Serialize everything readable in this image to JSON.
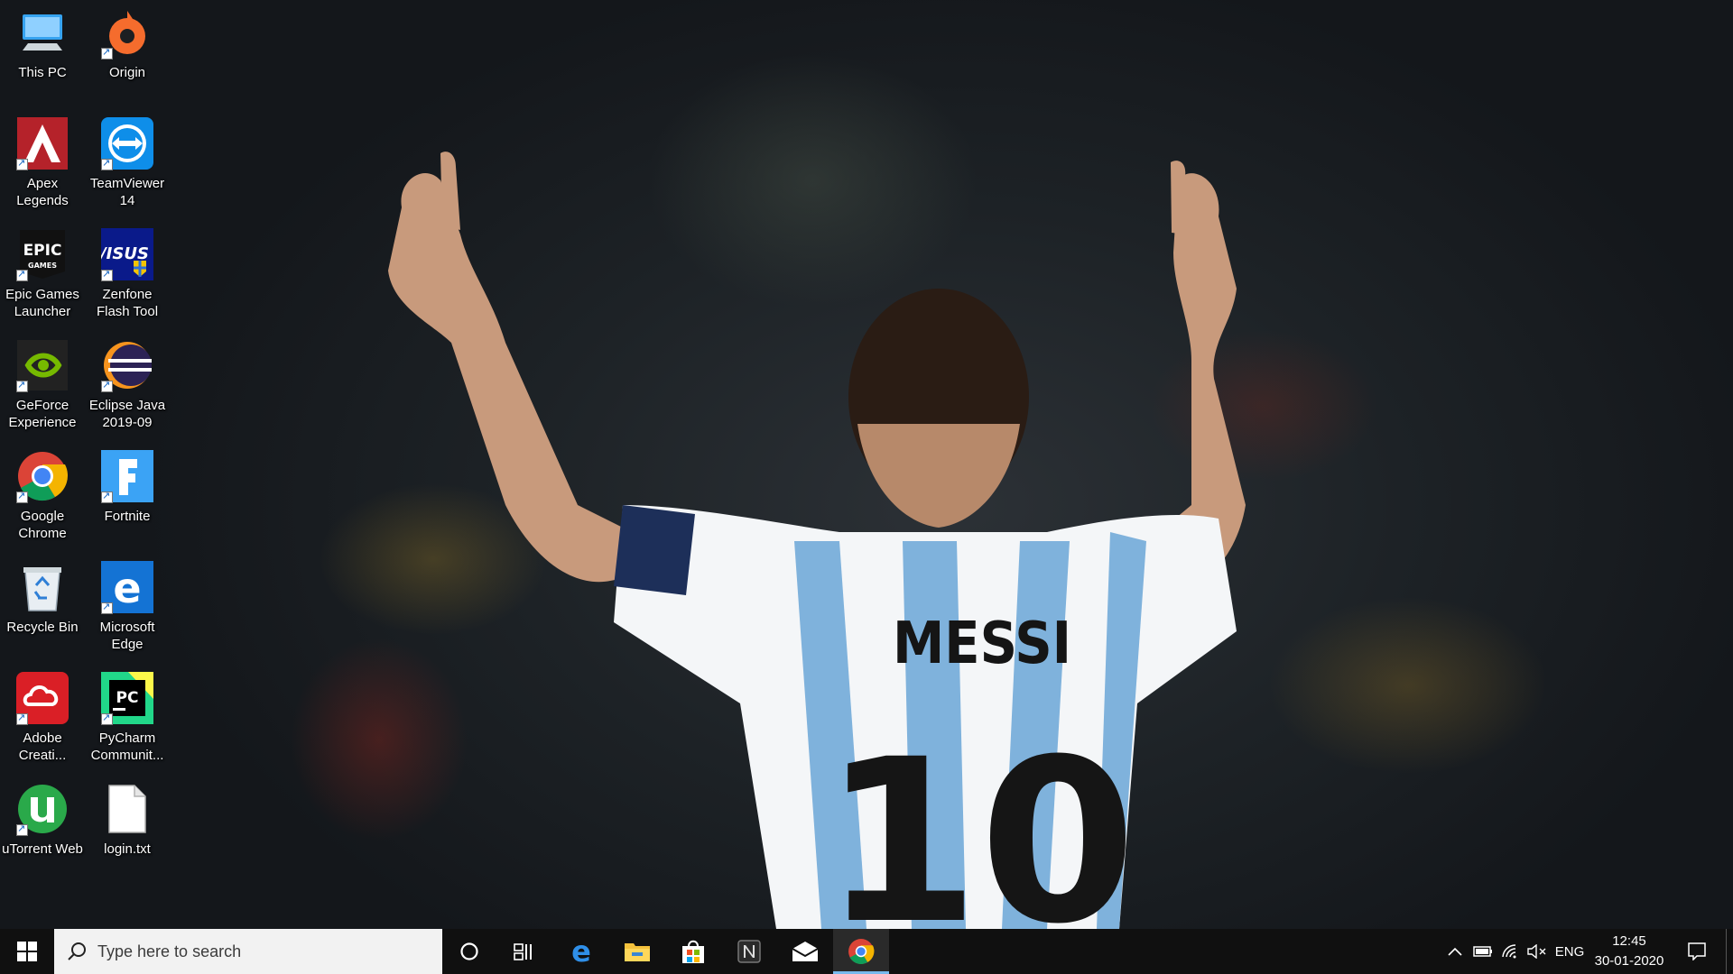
{
  "desktop": {
    "icons": [
      {
        "label": "This PC",
        "icon": "this-pc-icon",
        "shortcut": false
      },
      {
        "label": "Origin",
        "icon": "origin-icon",
        "shortcut": true
      },
      {
        "label": "Apex\nLegends",
        "icon": "apex-legends-icon",
        "shortcut": true
      },
      {
        "label": "TeamViewer\n14",
        "icon": "teamviewer-icon",
        "shortcut": true
      },
      {
        "label": "Epic Games\nLauncher",
        "icon": "epic-games-icon",
        "shortcut": true
      },
      {
        "label": "Zenfone\nFlash Tool",
        "icon": "asus-icon",
        "shortcut": true
      },
      {
        "label": "GeForce\nExperience",
        "icon": "geforce-icon",
        "shortcut": true
      },
      {
        "label": "Eclipse Java\n2019-09",
        "icon": "eclipse-icon",
        "shortcut": true
      },
      {
        "label": "Google\nChrome",
        "icon": "chrome-icon",
        "shortcut": true
      },
      {
        "label": "Fortnite",
        "icon": "fortnite-icon",
        "shortcut": true
      },
      {
        "label": "Recycle Bin",
        "icon": "recycle-bin-icon",
        "shortcut": false
      },
      {
        "label": "Microsoft\nEdge",
        "icon": "edge-icon",
        "shortcut": true
      },
      {
        "label": "Adobe\nCreati...",
        "icon": "adobe-cc-icon",
        "shortcut": true
      },
      {
        "label": "PyCharm\nCommunit...",
        "icon": "pycharm-icon",
        "shortcut": true
      },
      {
        "label": "uTorrent Web",
        "icon": "utorrent-icon",
        "shortcut": true
      },
      {
        "label": "login.txt",
        "icon": "text-file-icon",
        "shortcut": false
      }
    ]
  },
  "wallpaper": {
    "jersey_name": "MESSI",
    "jersey_number": "10"
  },
  "taskbar": {
    "search_placeholder": "Type here to search",
    "pinned": [
      "cortana-icon",
      "task-view-icon",
      "edge-icon",
      "file-explorer-icon",
      "store-icon",
      "notion-icon",
      "mail-icon",
      "chrome-icon"
    ],
    "active_app": "chrome-icon",
    "tray": {
      "language": "ENG",
      "time": "12:45",
      "date": "30-01-2020"
    }
  },
  "colors": {
    "taskbar": "#101010",
    "search_box": "#f2f2f2",
    "active_indicator": "#76b9ed"
  }
}
